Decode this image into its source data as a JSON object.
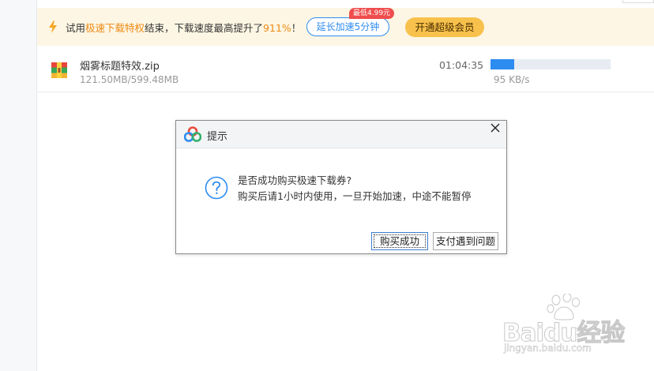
{
  "promo": {
    "icon": "lightning-icon",
    "text_prefix": "试用",
    "text_highlight": "极速下载特权",
    "text_mid": "结束，下载速度最高提升了",
    "text_percent": "911%",
    "text_suffix": "！",
    "extend_button": "延长加速5分钟",
    "price_badge": "最低4.99元",
    "vip_button": "开通超级会员",
    "accent_color": "#ef8a14"
  },
  "download": {
    "file_icon": "zip-archive-icon",
    "file_name": "烟雾标题特效.zip",
    "size_progress": "121.50MB/599.48MB",
    "time_remaining": "01:04:35",
    "progress_fraction": 0.2,
    "speed": "95 KB/s",
    "progress_color": "#2d8cf0"
  },
  "dialog": {
    "title": "提示",
    "logo_icon": "baidu-netdisk-logo",
    "question_icon": "question-circle-icon",
    "message_line1": "是否成功购买极速下载券?",
    "message_line2": "购买后请1小时内使用，一旦开始加速，中途不能暂停",
    "confirm_button": "购买成功",
    "problem_button": "支付遇到问题"
  },
  "watermark": {
    "brand": "Baidu经验",
    "url": "jingyan.baidu.com"
  }
}
